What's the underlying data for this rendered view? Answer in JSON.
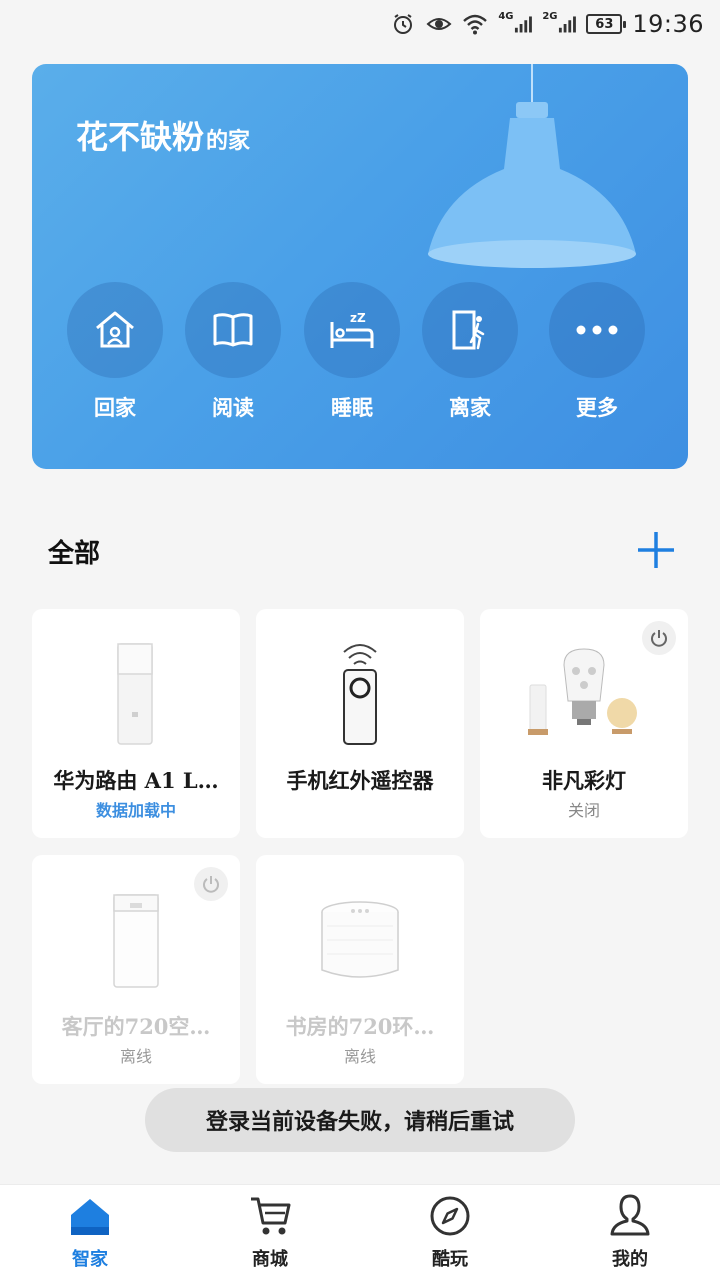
{
  "status_bar": {
    "net1": "4G",
    "net2": "2G",
    "battery": "63",
    "time": "19:36"
  },
  "hero": {
    "home_name": "花不缺粉",
    "home_suffix": "的家",
    "scenes": [
      {
        "label": "回家",
        "icon": "home-icon"
      },
      {
        "label": "阅读",
        "icon": "book-icon"
      },
      {
        "label": "睡眠",
        "icon": "sleep-bed-icon"
      },
      {
        "label": "离家",
        "icon": "leave-door-icon"
      },
      {
        "label": "更多",
        "icon": "more-dots-icon"
      }
    ]
  },
  "section": {
    "title": "全部"
  },
  "devices": [
    {
      "name": "华为路由 A1 L…",
      "status": "数据加载中",
      "icon": "router-icon"
    },
    {
      "name": "手机红外遥控器",
      "status": "",
      "icon": "remote-control-icon"
    },
    {
      "name": "非凡彩灯",
      "status": "关闭",
      "icon": "color-bulb-icon"
    },
    {
      "name": "客厅的720空…",
      "status": "离线",
      "icon": "air-purifier-icon"
    },
    {
      "name": "书房的720环…",
      "status": "离线",
      "icon": "environment-monitor-icon"
    }
  ],
  "toast": {
    "message": "登录当前设备失败，请稍后重试"
  },
  "bottom_nav": [
    {
      "label": "智家",
      "icon": "smart-home-icon",
      "active": true
    },
    {
      "label": "商城",
      "icon": "cart-icon",
      "active": false
    },
    {
      "label": "酷玩",
      "icon": "compass-icon",
      "active": false
    },
    {
      "label": "我的",
      "icon": "person-icon",
      "active": false
    }
  ],
  "colors": {
    "accent": "#1e7fe0",
    "hero_start": "#5aaeea",
    "hero_end": "#3e8fe2",
    "background": "#f5f5f5"
  }
}
